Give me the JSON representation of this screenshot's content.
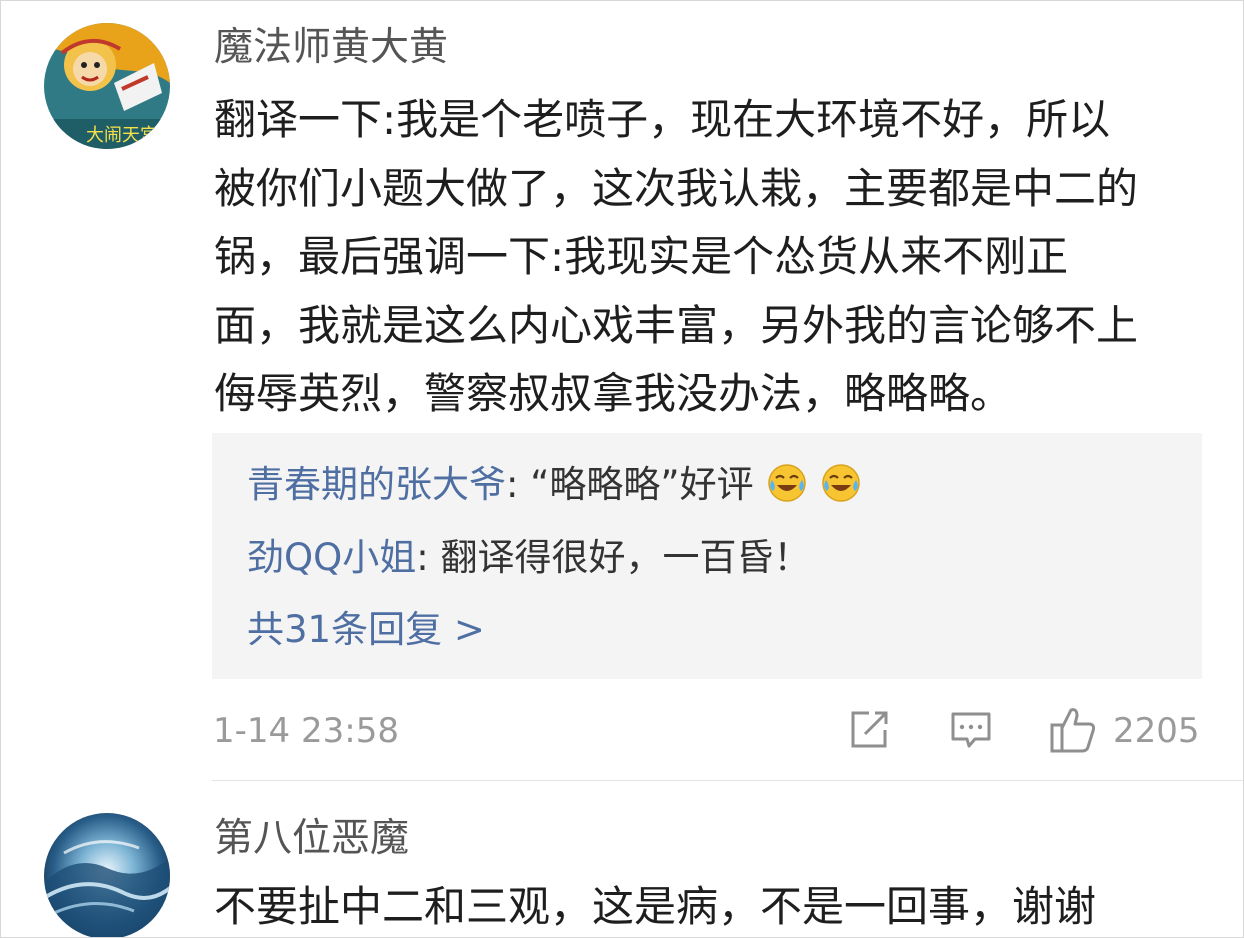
{
  "comments": [
    {
      "username": "魔法师黄大黄",
      "avatar_icon": "monkey-king-avatar",
      "body_lines": [
        "翻译一下:我是个老喷子，现在大环境不好，所以",
        "被你们小题大做了，这次我认栽，主要都是中二的",
        "锅，最后强调一下:我现实是个怂货从来不刚正",
        "面，我就是这么内心戏丰富，另外我的言论够不上",
        "侮辱英烈，警察叔叔拿我没办法，略略略。"
      ],
      "replies": [
        {
          "name": "青春期的张大爷",
          "sep": ": ",
          "text": "“略略略”好评",
          "emoji": "laugh-cry-emoji"
        },
        {
          "name": "劲QQ小姐",
          "sep": ": ",
          "text": "翻译得很好，一百昏！"
        }
      ],
      "more_replies": "共31条回复 >",
      "time": "1-14 23:58",
      "like_count": "2205"
    },
    {
      "username": "第八位恶魔",
      "avatar_icon": "ocean-wave-avatar",
      "body_lines": [
        "不要扯中二和三观，这是病，不是一回事，谢谢"
      ]
    }
  ],
  "colors": {
    "link": "#4f6fa3",
    "meta": "#9a9a9a",
    "reply_bg": "#f4f4f4"
  }
}
